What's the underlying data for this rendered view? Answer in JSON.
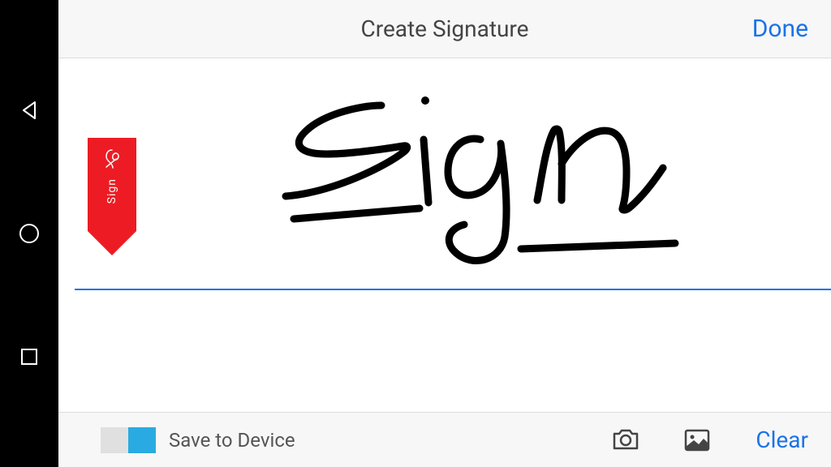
{
  "header": {
    "title": "Create Signature",
    "done_label": "Done"
  },
  "marker": {
    "label": "Sign"
  },
  "footer": {
    "toggle_label": "Save to Device",
    "clear_label": "Clear"
  }
}
